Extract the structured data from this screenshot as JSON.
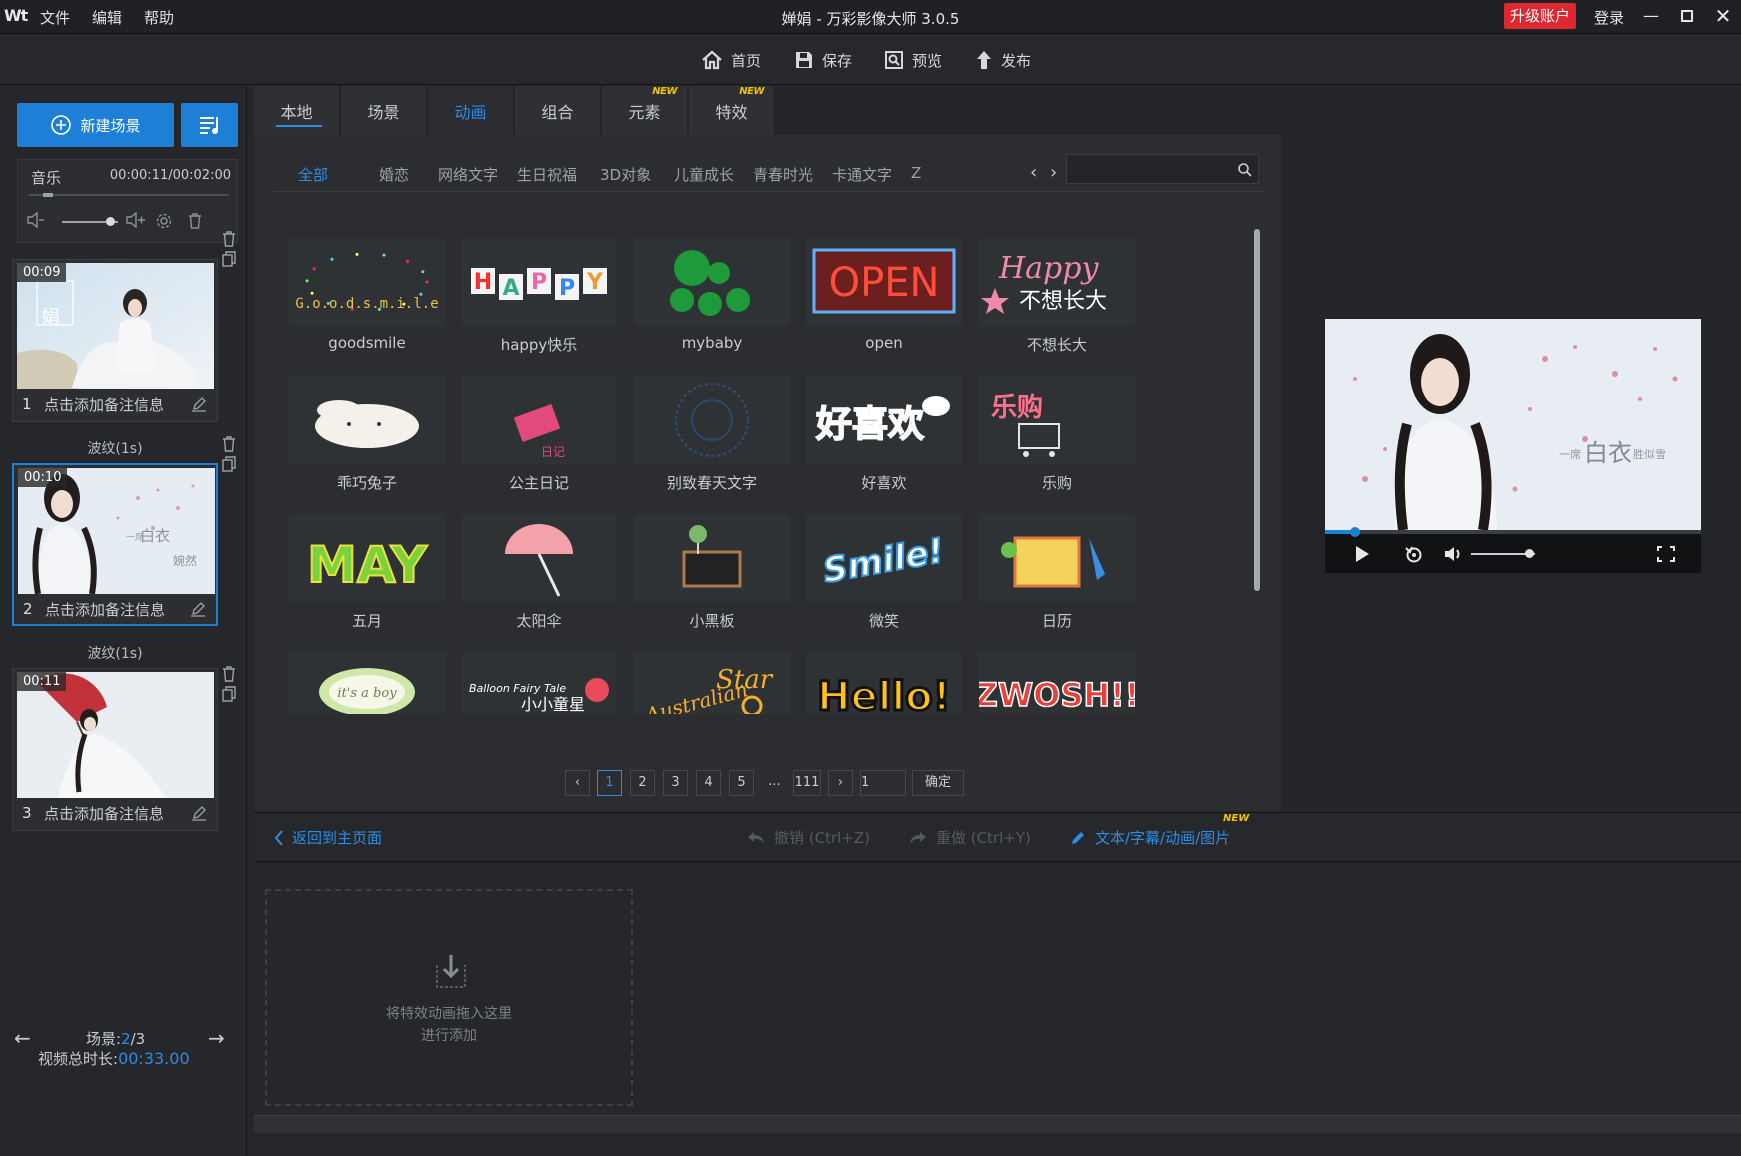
{
  "titlebar": {
    "logo": "Wt",
    "menus": [
      "文件",
      "编辑",
      "帮助"
    ],
    "title": "婵娟 - 万彩影像大师 3.0.5",
    "upgrade": "升级账户",
    "login": "登录"
  },
  "toolbar": {
    "home": "首页",
    "save": "保存",
    "preview": "预览",
    "publish": "发布"
  },
  "sidebar": {
    "new_scene": "新建场景",
    "music_label": "音乐",
    "music_time": "00:00:11/00:02:00",
    "music_volume": 0.85,
    "scenes": [
      {
        "badge": "00:09",
        "num": "1",
        "note": "点击添加备注信息",
        "overlay": "娟",
        "selected": false
      },
      {
        "badge": "00:10",
        "num": "2",
        "note": "点击添加备注信息",
        "overlay_main": "白衣",
        "overlay_sub": "一席",
        "overlay_sub2": "婉然",
        "selected": true
      },
      {
        "badge": "00:11",
        "num": "3",
        "note": "点击添加备注信息",
        "selected": false
      }
    ],
    "transitions": [
      "波纹(1s)",
      "波纹(1s)"
    ],
    "scene_label": "场景:",
    "scene_current": "2",
    "scene_total": "/3",
    "total_label": "视频总时长:",
    "total_time": "00:33.00"
  },
  "resource": {
    "tabs": [
      {
        "label": "本地",
        "new": false
      },
      {
        "label": "场景",
        "new": false
      },
      {
        "label": "动画",
        "new": false
      },
      {
        "label": "组合",
        "new": false
      },
      {
        "label": "元素",
        "new": true
      },
      {
        "label": "特效",
        "new": true
      }
    ],
    "active_tab": 2,
    "new_tag": "NEW",
    "categories": [
      "全部",
      "婚恋",
      "网络文字",
      "生日祝福",
      "3D对象",
      "儿童成长",
      "青春时光",
      "卡通文字",
      "Z"
    ],
    "search_placeholder": "",
    "items": [
      {
        "label": "goodsmile",
        "art": "Goodsmile"
      },
      {
        "label": "happy快乐",
        "art": "HAPPY"
      },
      {
        "label": "mybaby",
        "art": ""
      },
      {
        "label": "open",
        "art": "OPEN"
      },
      {
        "label": "不想长大",
        "art": "Happy",
        "art2": "不想长大"
      },
      {
        "label": "乖巧兔子",
        "art": ""
      },
      {
        "label": "公主日记",
        "art": "日记"
      },
      {
        "label": "别致春天文字",
        "art": ""
      },
      {
        "label": "好喜欢",
        "art": "好喜欢"
      },
      {
        "label": "乐购",
        "art": "乐购"
      },
      {
        "label": "五月",
        "art": "MAY"
      },
      {
        "label": "太阳伞",
        "art": ""
      },
      {
        "label": "小黑板",
        "art": ""
      },
      {
        "label": "微笑",
        "art": "Smile!"
      },
      {
        "label": "日历",
        "art": ""
      },
      {
        "label": "",
        "art": "it's a boy"
      },
      {
        "label": "",
        "art": "Balloon Fairy Tale",
        "art2": "小小童星"
      },
      {
        "label": "",
        "art": "Australian Star"
      },
      {
        "label": "",
        "art": "Hello!"
      },
      {
        "label": "",
        "art": "ZWOSH!!"
      }
    ],
    "pager": {
      "pages": [
        "1",
        "2",
        "3",
        "4",
        "5"
      ],
      "ellipsis": "...",
      "last": "111",
      "input": "1",
      "confirm": "确定"
    }
  },
  "actions": {
    "back": "返回到主页面",
    "undo": "撤销 (Ctrl+Z)",
    "redo": "重做 (Ctrl+Y)",
    "edit": "文本/字幕/动画/图片",
    "new_tag": "NEW"
  },
  "dropzone": {
    "line1": "将特效动画拖入这里",
    "line2": "进行添加"
  },
  "preview": {
    "overlay_main": "白衣",
    "overlay_sub": "一席",
    "overlay_sub2": "胜似雪",
    "progress": 0.08,
    "volume": 0.9
  },
  "colors": {
    "accent": "#1e7fd6",
    "upgrade": "#e0262f",
    "new_tag": "#f2c400"
  }
}
